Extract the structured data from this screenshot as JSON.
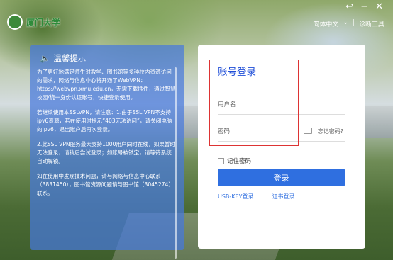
{
  "window_controls": {
    "back": "↩",
    "minimize": "−",
    "close": "✕"
  },
  "header": {
    "logo_text": "厦门大学",
    "language": "简体中文",
    "separator": "|",
    "diagnose": "诊断工具"
  },
  "notice": {
    "title": "温馨提示",
    "paragraphs": [
      "为了更好地满足师生对教学、图书馆等多种校内资源访问的需求，网络与信息中心将开通了WebVPN：https://webvpn.xmu.edu.cn，无需下载插件，通过智慧校园/统一身份认证账号，快捷登录使用。",
      "若继续使用本SSLVPN，请注意：1.由于SSL VPN不支持ipv6资源，若在使用时提示“403无法访问”，请关闭电脑的ipv6，退出账户后再次登录。",
      "2.此SSL VPN服务最大支持1000用户同时在线，如果暂时无法登录，请稍后尝试登录；如账号被锁定，请等待系统自动解锁。",
      "如在使用中发现技术问题，请与网络与信息中心联系（3831450），图书馆资源问题请与图书馆（3045274）联系。"
    ]
  },
  "login": {
    "title": "账号登录",
    "username_placeholder": "用户名",
    "password_placeholder": "密码",
    "forgot": "忘记密码?",
    "remember": "记住密码",
    "submit": "登录",
    "usb_key": "USB-KEY登录",
    "cert": "证书登录"
  },
  "colors": {
    "accent": "#2f6fe0",
    "notice_bg": "#4678dc",
    "highlight": "#dd3333"
  }
}
